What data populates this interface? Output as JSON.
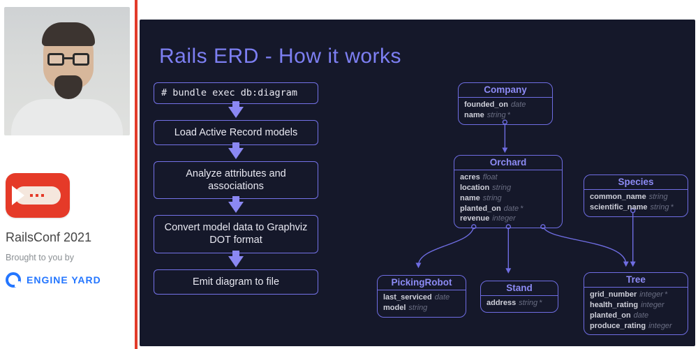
{
  "sidebar": {
    "conference": "RailsConf 2021",
    "brought_by": "Brought to you by",
    "sponsor": "ENGINE YARD"
  },
  "slide": {
    "title": "Rails ERD - How it works",
    "flow": [
      "# bundle exec db:diagram",
      "Load Active Record models",
      "Analyze attributes and associations",
      "Convert model data to Graphviz DOT format",
      "Emit diagram to file"
    ],
    "entities": {
      "company": {
        "name": "Company",
        "attrs": [
          {
            "n": "founded_on",
            "t": "date"
          },
          {
            "n": "name",
            "t": "string",
            "req": true
          }
        ]
      },
      "orchard": {
        "name": "Orchard",
        "attrs": [
          {
            "n": "acres",
            "t": "float"
          },
          {
            "n": "location",
            "t": "string"
          },
          {
            "n": "name",
            "t": "string"
          },
          {
            "n": "planted_on",
            "t": "date",
            "req": true
          },
          {
            "n": "revenue",
            "t": "integer"
          }
        ]
      },
      "species": {
        "name": "Species",
        "attrs": [
          {
            "n": "common_name",
            "t": "string"
          },
          {
            "n": "scientific_name",
            "t": "string",
            "req": true
          }
        ]
      },
      "picking_robot": {
        "name": "PickingRobot",
        "attrs": [
          {
            "n": "last_serviced",
            "t": "date"
          },
          {
            "n": "model",
            "t": "string"
          }
        ]
      },
      "stand": {
        "name": "Stand",
        "attrs": [
          {
            "n": "address",
            "t": "string",
            "req": true
          }
        ]
      },
      "tree": {
        "name": "Tree",
        "attrs": [
          {
            "n": "grid_number",
            "t": "integer",
            "req": true
          },
          {
            "n": "health_rating",
            "t": "integer"
          },
          {
            "n": "planted_on",
            "t": "date"
          },
          {
            "n": "produce_rating",
            "t": "integer"
          }
        ]
      }
    },
    "relations": [
      {
        "from": "company",
        "to": "orchard"
      },
      {
        "from": "orchard",
        "to": "picking_robot"
      },
      {
        "from": "orchard",
        "to": "stand"
      },
      {
        "from": "orchard",
        "to": "tree"
      },
      {
        "from": "species",
        "to": "tree"
      }
    ]
  },
  "chart_data": {
    "type": "erd-diagram",
    "process_steps": [
      "# bundle exec db:diagram",
      "Load Active Record models",
      "Analyze attributes and associations",
      "Convert model data to Graphviz DOT format",
      "Emit diagram to file"
    ],
    "entities": [
      {
        "name": "Company",
        "attributes": [
          [
            "founded_on",
            "date"
          ],
          [
            "name",
            "string*"
          ]
        ]
      },
      {
        "name": "Orchard",
        "attributes": [
          [
            "acres",
            "float"
          ],
          [
            "location",
            "string"
          ],
          [
            "name",
            "string"
          ],
          [
            "planted_on",
            "date*"
          ],
          [
            "revenue",
            "integer"
          ]
        ]
      },
      {
        "name": "Species",
        "attributes": [
          [
            "common_name",
            "string"
          ],
          [
            "scientific_name",
            "string*"
          ]
        ]
      },
      {
        "name": "PickingRobot",
        "attributes": [
          [
            "last_serviced",
            "date"
          ],
          [
            "model",
            "string"
          ]
        ]
      },
      {
        "name": "Stand",
        "attributes": [
          [
            "address",
            "string*"
          ]
        ]
      },
      {
        "name": "Tree",
        "attributes": [
          [
            "grid_number",
            "integer*"
          ],
          [
            "health_rating",
            "integer"
          ],
          [
            "planted_on",
            "date"
          ],
          [
            "produce_rating",
            "integer"
          ]
        ]
      }
    ],
    "edges": [
      [
        "Company",
        "Orchard"
      ],
      [
        "Orchard",
        "PickingRobot"
      ],
      [
        "Orchard",
        "Stand"
      ],
      [
        "Orchard",
        "Tree"
      ],
      [
        "Species",
        "Tree"
      ]
    ]
  }
}
